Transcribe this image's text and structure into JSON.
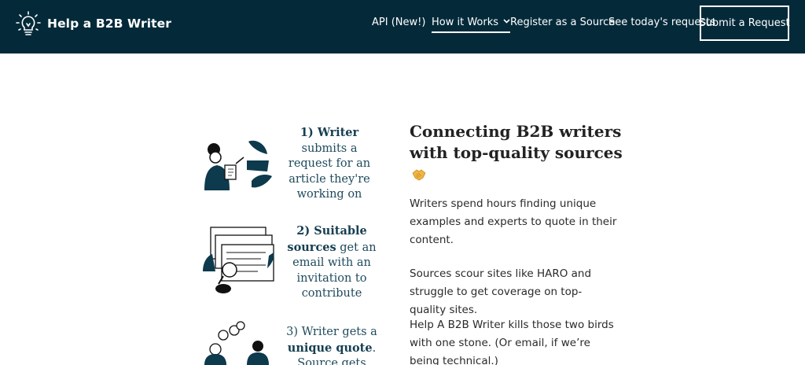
{
  "header": {
    "logo_text": "Help a B2B Writer",
    "nav": [
      {
        "label": "API (New!)"
      },
      {
        "label": "How it Works"
      },
      {
        "label": "Register as a Source"
      },
      {
        "label": "See today's requests"
      }
    ],
    "cta_label": "Submit a Request"
  },
  "steps": [
    {
      "strong": "1) Writer",
      "text": "submits a request for an article they're working on"
    },
    {
      "strong_a": "2) Suitable",
      "strong_b": "sources",
      "text_b": "get an email with an invitation to contribute"
    },
    {
      "text_a": "3) Writer gets a",
      "strong": "unique quote",
      "tail": ".",
      "text_b": "Source gets"
    }
  ],
  "content": {
    "headline": "Connecting B2B writers with top-quality sources",
    "emoji_icon": "handshake-icon",
    "paragraphs": [
      "Writers spend hours finding unique examples and experts to quote in their content.",
      "Sources scour sites like HARO and struggle to get coverage on top-quality sites.",
      "Help A B2B Writer kills those two birds with one stone. (Or email, if we’re being technical.)"
    ]
  },
  "colors": {
    "header_bg": "#042a3a",
    "accent_text": "#1f4a5c",
    "emoji": "#f0b542"
  }
}
